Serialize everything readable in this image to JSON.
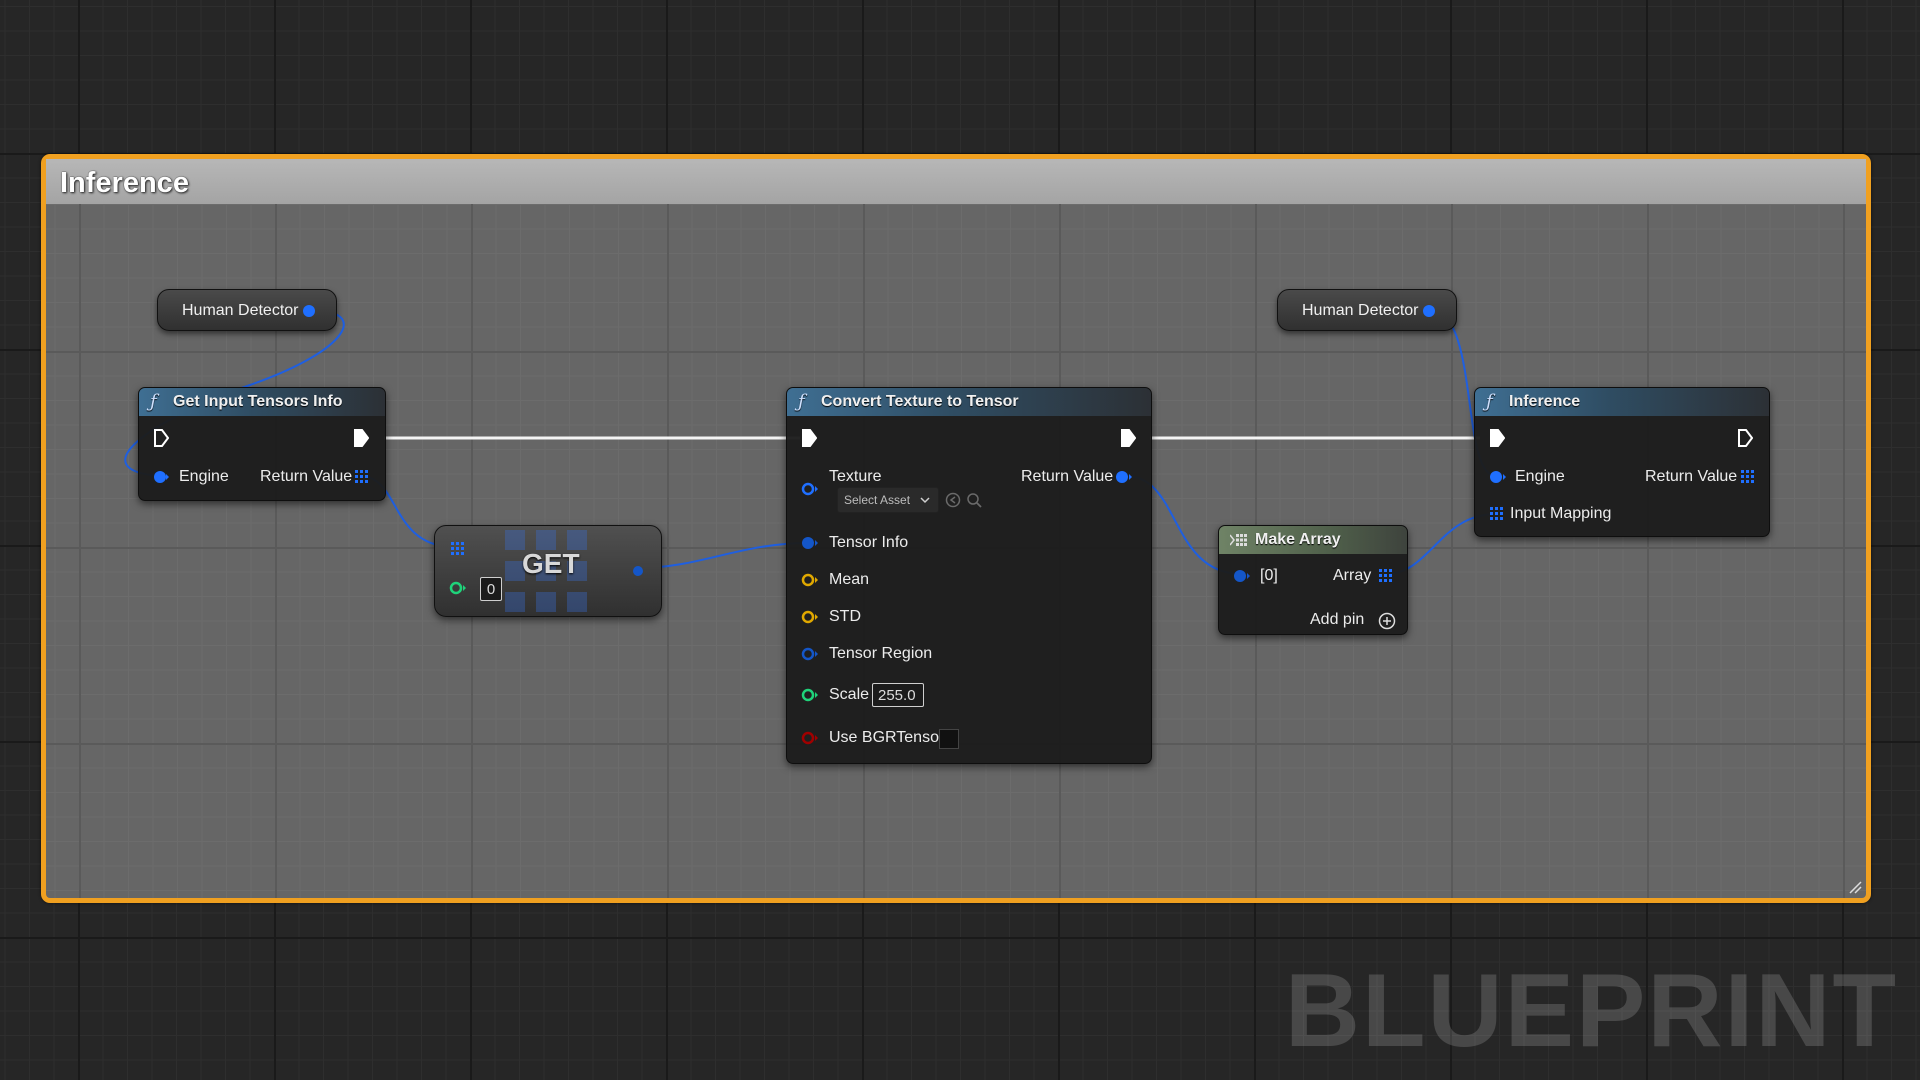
{
  "comment": {
    "title": "Inference"
  },
  "variables": [
    {
      "label": "Human Detector"
    },
    {
      "label": "Human Detector"
    }
  ],
  "get_input_tensors_info": {
    "title": "Get Input Tensors Info",
    "inputs": [
      "Engine"
    ],
    "outputs": [
      "Return Value"
    ]
  },
  "get_node": {
    "label": "GET",
    "index": "0"
  },
  "convert_texture_to_tensor": {
    "title": "Convert Texture to Tensor",
    "texture_label": "Texture",
    "texture_select": "Select Asset",
    "return_label": "Return Value",
    "tensor_info": "Tensor Info",
    "mean": "Mean",
    "std": "STD",
    "tensor_region": "Tensor Region",
    "scale_label": "Scale",
    "scale_value": "255.0",
    "use_bgr": "Use BGRTensor"
  },
  "make_array": {
    "title": "Make Array",
    "input_label": "[0]",
    "output_label": "Array",
    "add_pin": "Add pin"
  },
  "inference_node": {
    "title": "Inference",
    "engine": "Engine",
    "return_label": "Return Value",
    "input_mapping": "Input Mapping"
  },
  "watermark": "BLUEPRINT",
  "colors": {
    "comment_border": "#f0a020",
    "object_pin": "#1f6fff",
    "struct_pin": "#1456c8",
    "float_pin": "#e0a800",
    "int_pin": "#1fd37a",
    "bool_pin": "#a00000",
    "exec_pin": "#ffffff"
  }
}
